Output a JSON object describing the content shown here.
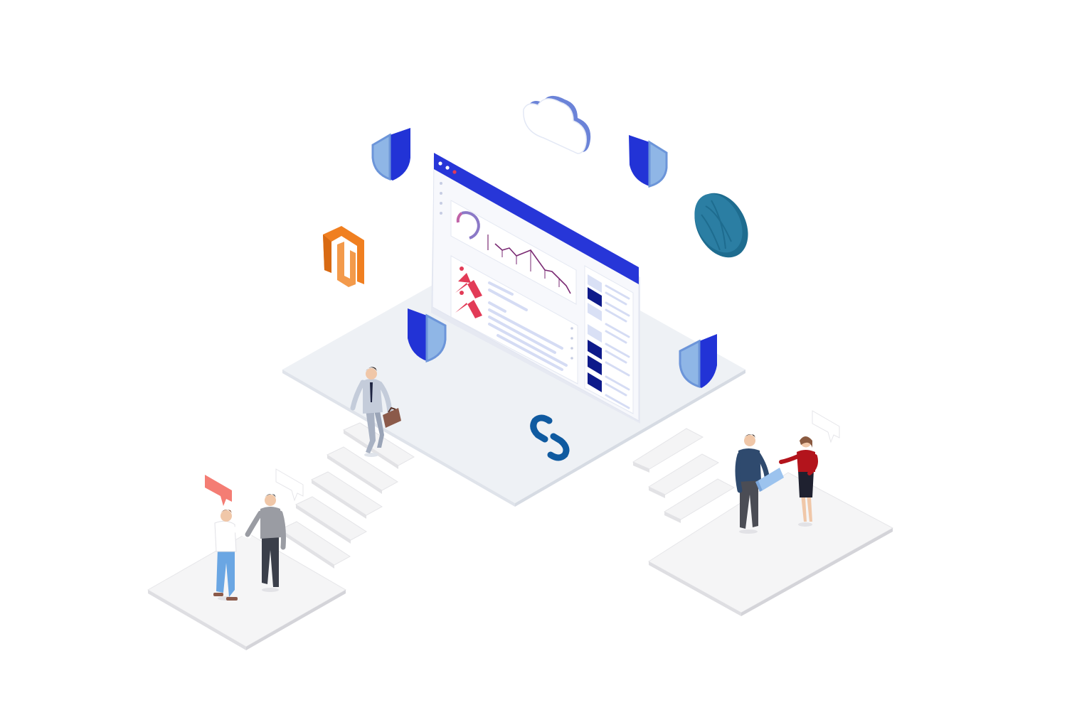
{
  "scene": {
    "description_text": "",
    "colors": {
      "platform_top": "#eef1f5",
      "platform_side": "#dfe3ea",
      "tile_top": "#f4f4f5",
      "tile_side": "#e2e2e5",
      "browser_bar": "#2736d8",
      "browser_body": "#f7f8fc",
      "shield_dark": "#2233d6",
      "shield_light": "#8fb6e6",
      "cloud_outline": "#6b83d8",
      "globe": "#1e6c8f",
      "magento_orange": "#f07f20",
      "accent_red": "#e23b57",
      "chart_purple": "#7a2a73",
      "sidebar_navy": "#0e1a8a",
      "link_blue": "#0f5aa0",
      "speech_bubble": "#f47d74"
    },
    "icons": [
      "shield-icon",
      "cloud-icon",
      "globe-icon",
      "magento-logo-icon",
      "link-icon",
      "speech-bubble-icon",
      "laptop-icon",
      "briefcase-icon",
      "donut-chart-icon",
      "line-chart-icon",
      "image-placeholder-icon"
    ]
  }
}
